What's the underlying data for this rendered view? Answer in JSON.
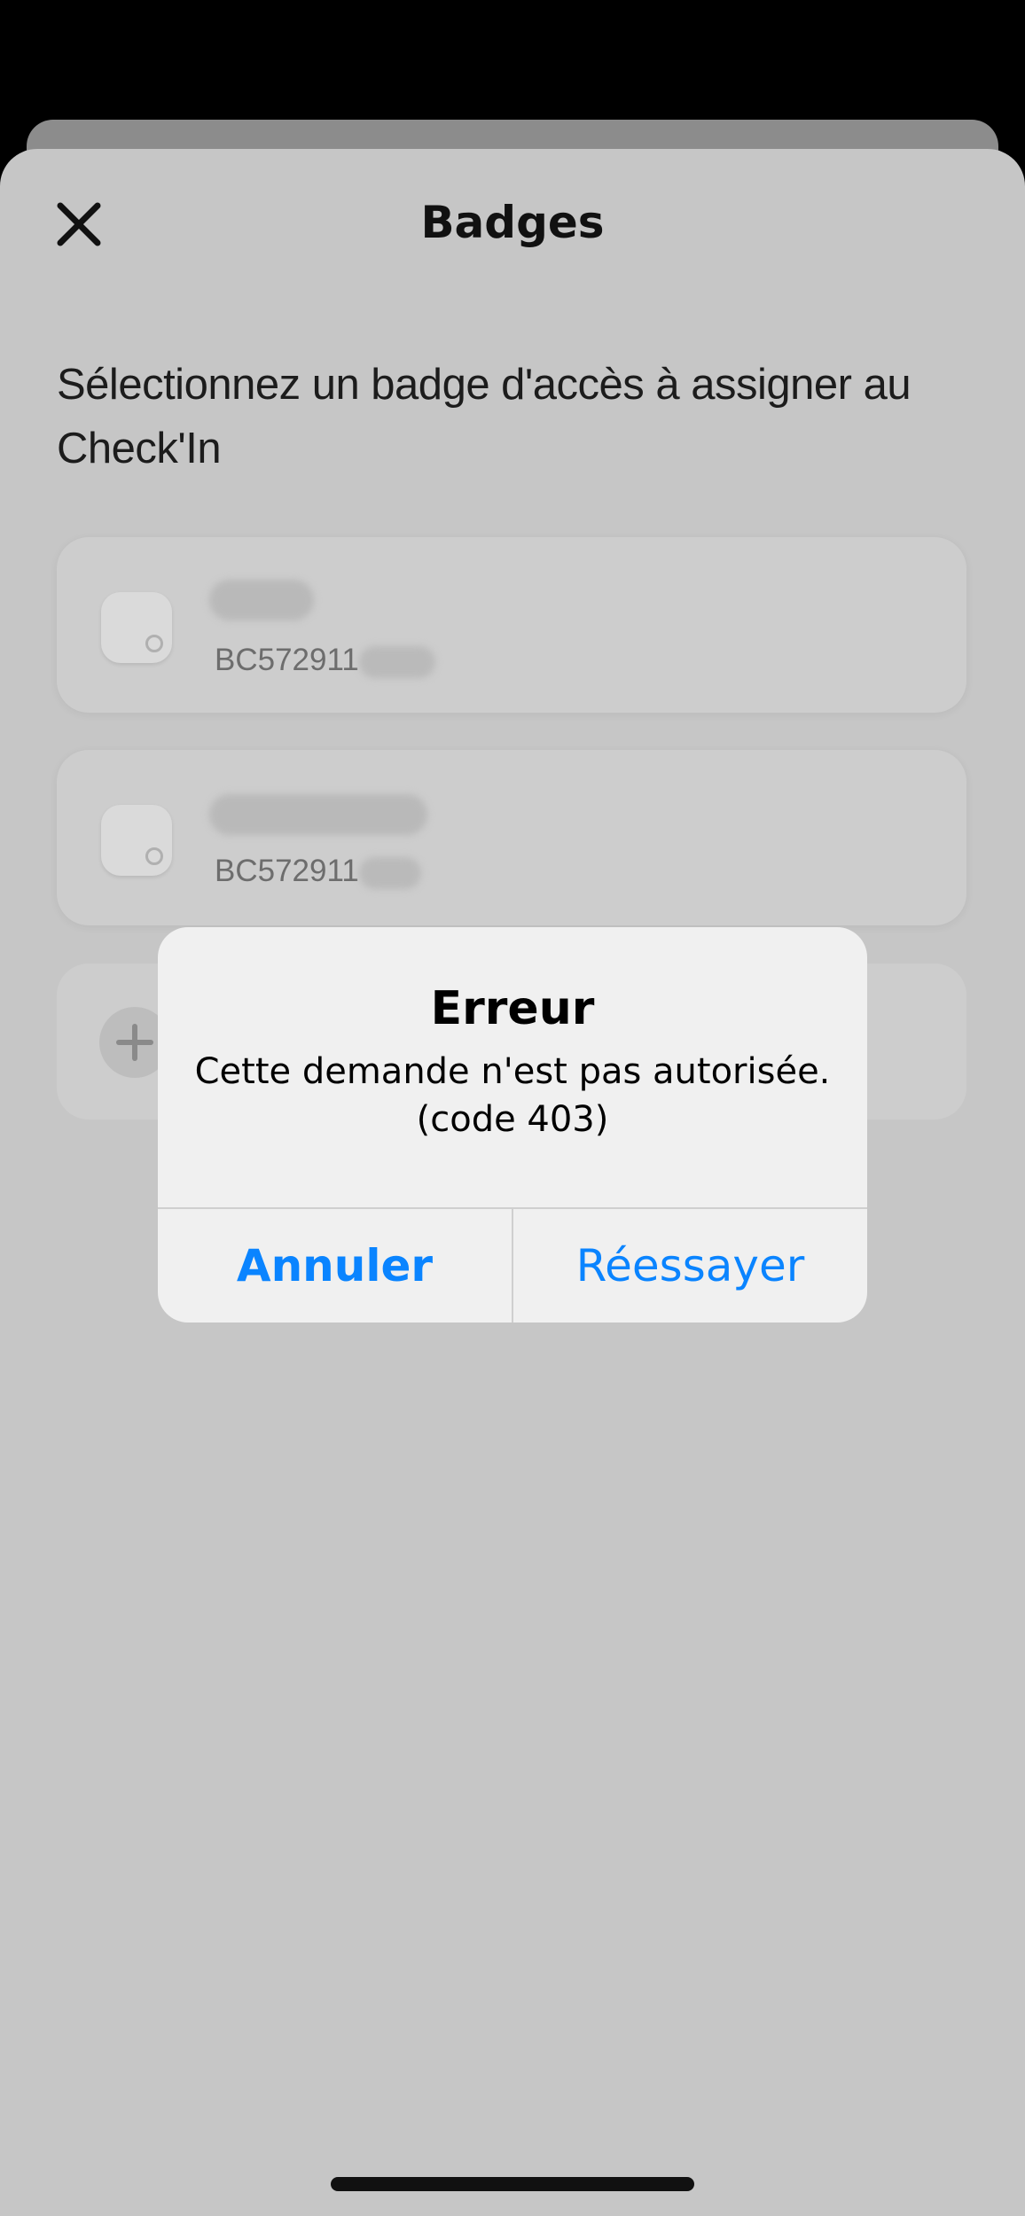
{
  "sheet": {
    "title": "Badges",
    "instruction": "Sélectionnez un badge d'accès à assigner au Check'In"
  },
  "badges": [
    {
      "serial": "BC572911"
    },
    {
      "serial": "BC572911"
    }
  ],
  "alert": {
    "title": "Erreur",
    "message": "Cette demande n'est pas autorisée. (code 403)",
    "cancel_label": "Annuler",
    "retry_label": "Réessayer"
  },
  "colors": {
    "accent": "#0a84ff",
    "sheet_background": "#c6c6c6",
    "alert_background": "#f0f0f0"
  },
  "icons": {
    "close": "close-icon",
    "badge": "badge-tag-icon",
    "add": "plus-icon"
  }
}
